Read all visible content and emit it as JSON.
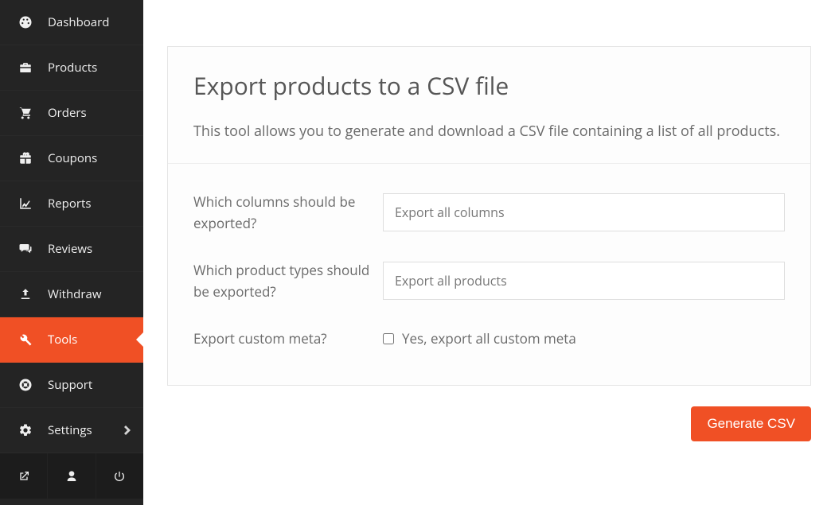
{
  "sidebar": {
    "items": [
      {
        "label": "Dashboard",
        "icon": "dashboard-icon"
      },
      {
        "label": "Products",
        "icon": "briefcase-icon"
      },
      {
        "label": "Orders",
        "icon": "cart-icon"
      },
      {
        "label": "Coupons",
        "icon": "gift-icon"
      },
      {
        "label": "Reports",
        "icon": "chart-icon"
      },
      {
        "label": "Reviews",
        "icon": "comments-icon"
      },
      {
        "label": "Withdraw",
        "icon": "upload-icon"
      },
      {
        "label": "Tools",
        "icon": "wrench-icon",
        "active": true
      },
      {
        "label": "Support",
        "icon": "lifering-icon"
      },
      {
        "label": "Settings",
        "icon": "gear-icon",
        "chevron": true
      }
    ],
    "footer": [
      "external-link-icon",
      "user-icon",
      "power-icon"
    ]
  },
  "panel": {
    "title": "Export products to a CSV file",
    "description": "This tool allows you to generate and download a CSV file containing a list of all products."
  },
  "form": {
    "columns_label": "Which columns should be exported?",
    "columns_value": "Export all columns",
    "types_label": "Which product types should be exported?",
    "types_value": "Export all products",
    "meta_label": "Export custom meta?",
    "meta_checkbox_label": "Yes, export all custom meta",
    "meta_checked": false
  },
  "actions": {
    "generate_label": "Generate CSV"
  }
}
